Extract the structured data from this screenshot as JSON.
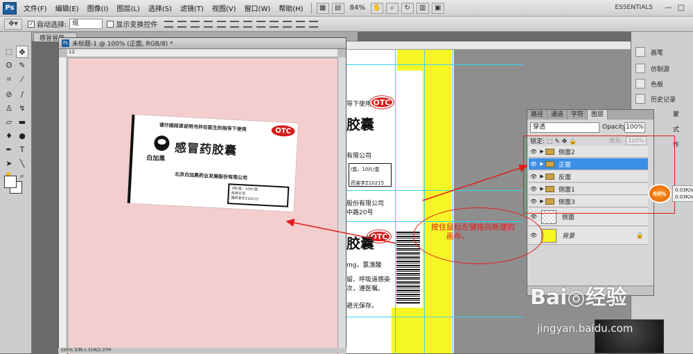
{
  "menubar": {
    "logo": "Ps",
    "items": [
      "文件(F)",
      "编辑(E)",
      "图像(I)",
      "图层(L)",
      "选择(S)",
      "滤镜(T)",
      "视图(V)",
      "窗口(W)",
      "帮助(H)"
    ],
    "zoom": "84%",
    "workspace": "ESSENTIALS",
    "minimize": "—",
    "maximize": "□"
  },
  "options": {
    "auto_select_label": "自动选择:",
    "auto_select_value": "组",
    "transform_controls_label": "显示变换控件"
  },
  "tabs": {
    "background_doc_tab": "感冒冒药..."
  },
  "document": {
    "title": "未标题-1 @ 100% (正面, RGB/8) *",
    "ruler_mark": "12",
    "status": "100%     文档:1.31M/2.37M"
  },
  "card": {
    "instruction": "请仔细阅读说明书并在医生的指导下使用",
    "otc": "OTC",
    "product_name": "感冒药胶囊",
    "brand": "白加黑",
    "company": "北京白加黑药业发展股份有限公司",
    "box_line1": "2粒/盒，10片/盒",
    "box_line2": "批准文号:",
    "box_line3": "国药准字Z10215"
  },
  "bg_doc": {
    "otc": "OTC",
    "use_label": "导下使用",
    "product_short": "胶囊",
    "company_short": "有限公司",
    "spec": "/盒，10片/盒",
    "approval": "药准字Z10215",
    "company2": "股份有限公司",
    "addr": "中路20号",
    "ingredients": "mg，氯溴酸",
    "usage1": "留、呼吸道感染",
    "usage2": "次，遵医嘱。",
    "storage": "避光保存。"
  },
  "panel_icons": [
    {
      "label": "画笔"
    },
    {
      "label": "仿制源"
    },
    {
      "label": "色板"
    },
    {
      "label": "历史记录"
    },
    {
      "label": "蒙"
    },
    {
      "label": "式"
    },
    {
      "label": "作"
    }
  ],
  "layers": {
    "tabs": [
      "路径",
      "通道",
      "字符",
      "图层"
    ],
    "blend_mode": "穿透",
    "opacity_label": "Opacity:",
    "opacity_value": "100%",
    "lock_label": "锁定:",
    "fill_label": "填充:",
    "fill_value": "100%",
    "rows": [
      {
        "name": "侧面2",
        "type": "group",
        "selected": false
      },
      {
        "name": "正面",
        "type": "group",
        "selected": true
      },
      {
        "name": "反面",
        "type": "group",
        "selected": false
      },
      {
        "name": "侧面1",
        "type": "group",
        "selected": false
      },
      {
        "name": "侧面3",
        "type": "group",
        "selected": false
      },
      {
        "name": "侧面",
        "type": "layer",
        "selected": false
      },
      {
        "name": "背景",
        "type": "background",
        "selected": false
      }
    ]
  },
  "annotation": {
    "text_line1": "按住鼠标左键拖向新建的",
    "text_line2": "画布。",
    "color": "#e21b1b"
  },
  "speed": {
    "percent": "60%",
    "up": "0.03K/s",
    "down": "0.03K/s"
  },
  "watermark": {
    "brand": "Bai◎经验",
    "url": "jingyan.baidu.com"
  },
  "colors": {
    "canvas": "#f4cece",
    "selected_layer": "#3a8ee6",
    "package_yellow": "#f6f626",
    "guide": "#37d4f0",
    "otc_red": "#d41e1e"
  }
}
